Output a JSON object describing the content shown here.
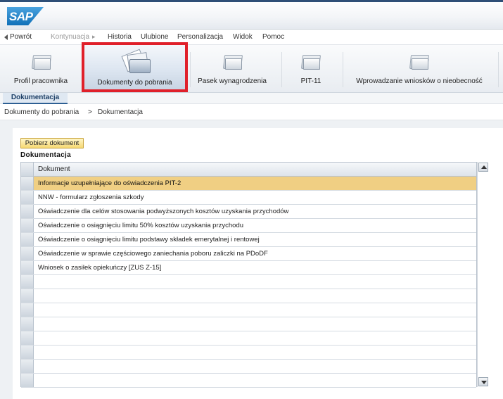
{
  "logo": {
    "text": "SAP"
  },
  "menu": {
    "back": "Powrót",
    "forward": "Kontynuacja",
    "items": [
      "Historia",
      "Ulubione",
      "Personalizacja",
      "Widok",
      "Pomoc"
    ]
  },
  "tabs": [
    {
      "label": "Profil pracownika",
      "icon": "folder-icon"
    },
    {
      "label": "Dokumenty do pobrania",
      "icon": "documents-icon",
      "active": true
    },
    {
      "label": "Pasek wynagrodzenia",
      "icon": "folder-icon"
    },
    {
      "label": "PIT-11",
      "icon": "folder-icon"
    },
    {
      "label": "Wprowadzanie wniosków o nieobecność",
      "icon": "folder-icon"
    }
  ],
  "subtab": {
    "label": "Dokumentacja"
  },
  "breadcrumb": {
    "root": "Dokumenty do pobrania",
    "separator": ">",
    "current": "Dokumentacja"
  },
  "toolbar": {
    "download_label": "Pobierz dokument"
  },
  "section": {
    "title": "Dokumentacja"
  },
  "table": {
    "column": "Dokument",
    "selected_index": 0,
    "rows": [
      "Informacje uzupełniające do oświadczenia PIT-2",
      "NNW - formularz zgłoszenia szkody",
      "Oświadczenie dla celów stosowania podwyższonych kosztów uzyskania przychodów",
      "Oświadczenie o osiągnięciu limitu 50% kosztów uzyskania przychodu",
      "Oświadczenie o osiągnięciu limitu podstawy składek emerytalnej i rentowej",
      "Oświadczenie w sprawie częściowego zaniechania poboru zaliczki na PDoDF",
      "Wniosek o zasiłek opiekuńczy [ZUS Z-15]"
    ]
  },
  "colors": {
    "accent": "#2d5f93",
    "selected_row": "#f0cf83",
    "highlight_border": "#e0202a",
    "button": "#f6d873"
  }
}
